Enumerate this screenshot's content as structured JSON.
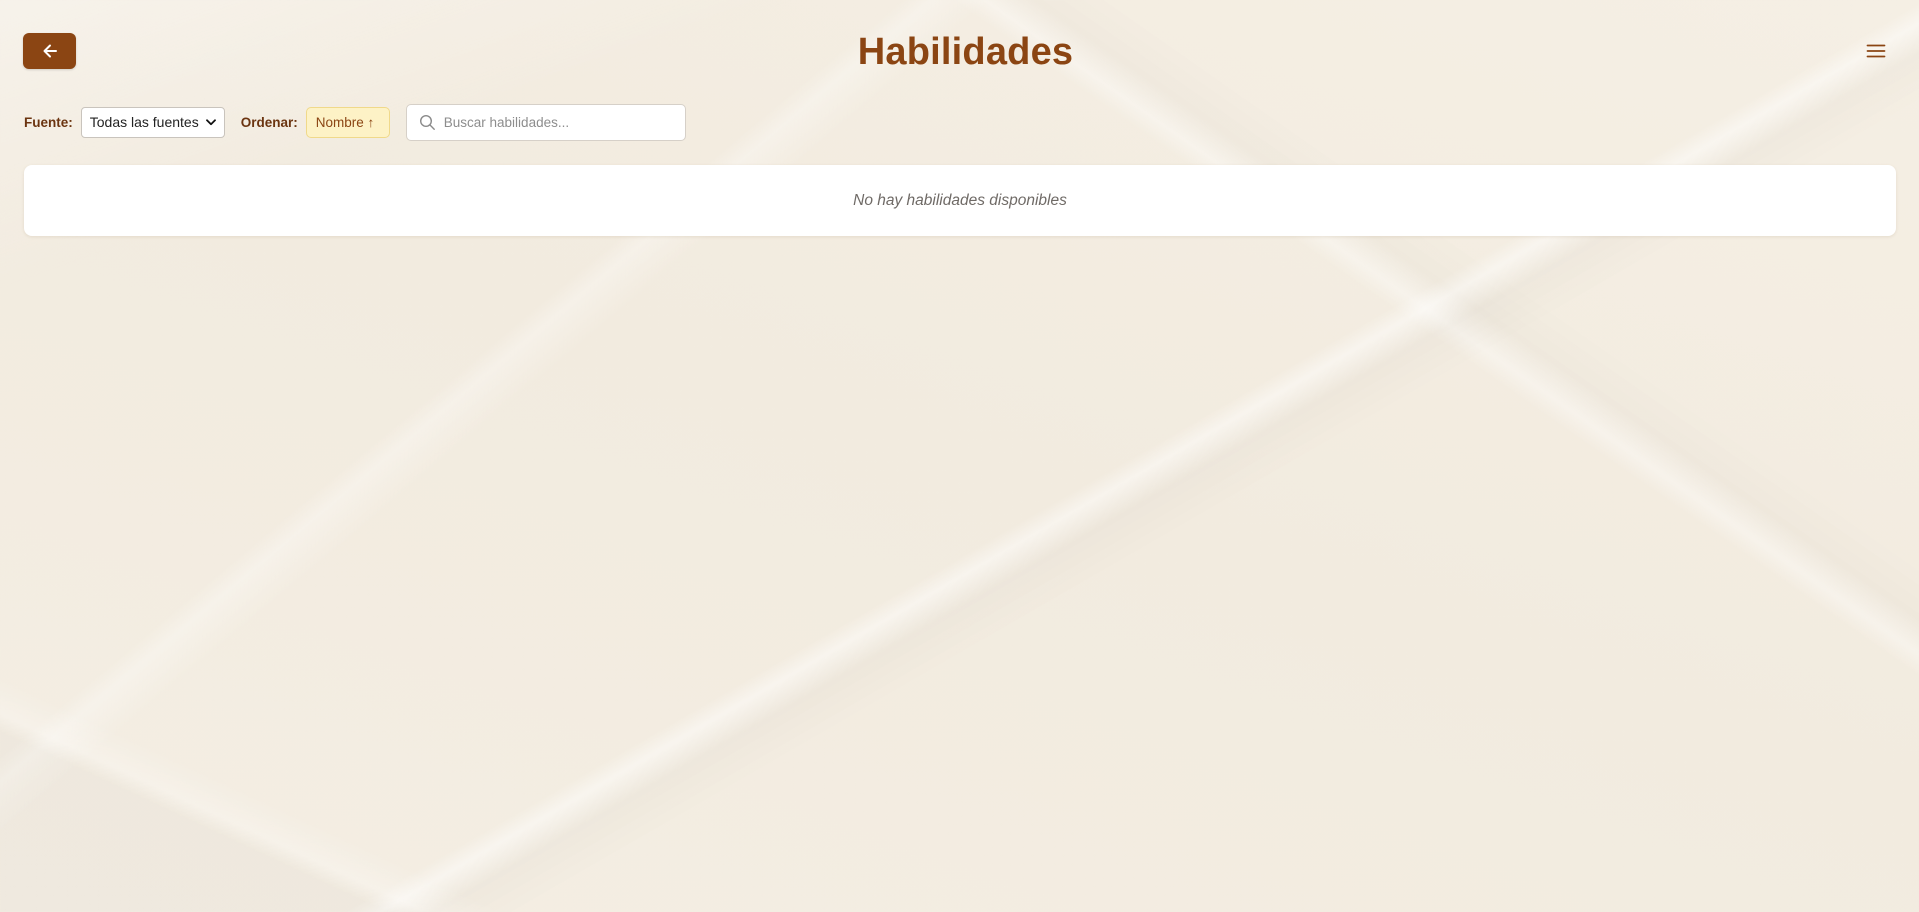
{
  "page": {
    "title": "Habilidades"
  },
  "filters": {
    "source_label": "Fuente:",
    "source_selected": "Todas las fuentes",
    "sort_label": "Ordenar:",
    "sort_value": "Nombre ↑",
    "search_placeholder": "Buscar habilidades..."
  },
  "results": {
    "empty_message": "No hay habilidades disponibles"
  },
  "icons": {
    "back": "arrow-left-icon",
    "menu": "hamburger-menu-icon",
    "search": "search-icon",
    "dropdown": "chevron-down-icon"
  },
  "colors": {
    "brand": "#8b4513",
    "sort_chip_bg": "#fdf2c6",
    "background": "#f4ede2"
  }
}
